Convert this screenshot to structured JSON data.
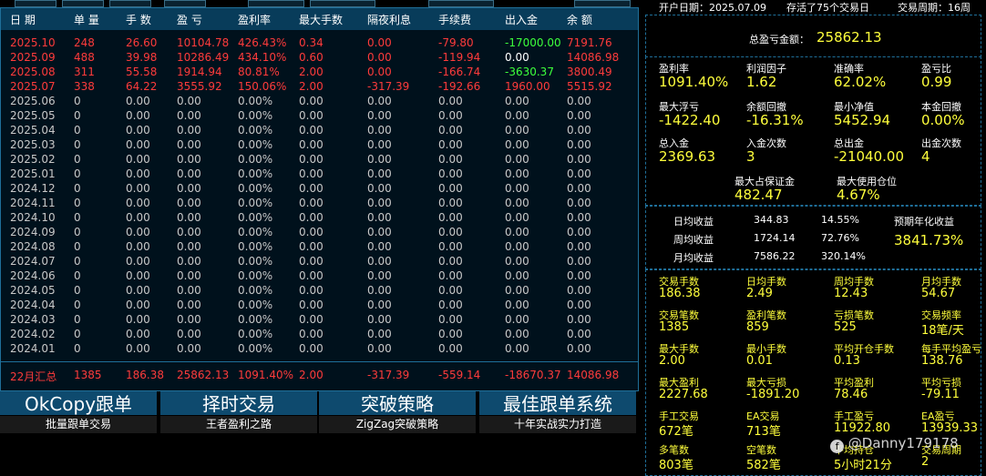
{
  "table": {
    "headers": [
      "日 期",
      "单 量",
      "手 数",
      "盈 亏",
      "盈利率",
      "最大手数",
      "隔夜利息",
      "手续费",
      "出入金",
      "余 额"
    ],
    "rows": [
      [
        "2025.10",
        "248",
        "26.60",
        "10104.78",
        "426.43%",
        "0.34",
        "0.00",
        "-79.80",
        "-17000.00",
        "7191.76"
      ],
      [
        "2025.09",
        "488",
        "39.98",
        "10286.49",
        "434.10%",
        "0.60",
        "0.00",
        "-119.94",
        "0.00",
        "14086.98"
      ],
      [
        "2025.08",
        "311",
        "55.58",
        "1914.94",
        "80.81%",
        "2.00",
        "0.00",
        "-166.74",
        "-3630.37",
        "3800.49"
      ],
      [
        "2025.07",
        "338",
        "64.22",
        "3555.92",
        "150.06%",
        "2.00",
        "-317.39",
        "-192.66",
        "1960.00",
        "5515.92"
      ],
      [
        "2025.06",
        "0",
        "0.00",
        "0.00",
        "0.00%",
        "0.00",
        "0.00",
        "0.00",
        "0.00",
        "0.00"
      ],
      [
        "2025.05",
        "0",
        "0.00",
        "0.00",
        "0.00%",
        "0.00",
        "0.00",
        "0.00",
        "0.00",
        "0.00"
      ],
      [
        "2025.04",
        "0",
        "0.00",
        "0.00",
        "0.00%",
        "0.00",
        "0.00",
        "0.00",
        "0.00",
        "0.00"
      ],
      [
        "2025.03",
        "0",
        "0.00",
        "0.00",
        "0.00%",
        "0.00",
        "0.00",
        "0.00",
        "0.00",
        "0.00"
      ],
      [
        "2025.02",
        "0",
        "0.00",
        "0.00",
        "0.00%",
        "0.00",
        "0.00",
        "0.00",
        "0.00",
        "0.00"
      ],
      [
        "2025.01",
        "0",
        "0.00",
        "0.00",
        "0.00%",
        "0.00",
        "0.00",
        "0.00",
        "0.00",
        "0.00"
      ],
      [
        "2024.12",
        "0",
        "0.00",
        "0.00",
        "0.00%",
        "0.00",
        "0.00",
        "0.00",
        "0.00",
        "0.00"
      ],
      [
        "2024.11",
        "0",
        "0.00",
        "0.00",
        "0.00%",
        "0.00",
        "0.00",
        "0.00",
        "0.00",
        "0.00"
      ],
      [
        "2024.10",
        "0",
        "0.00",
        "0.00",
        "0.00%",
        "0.00",
        "0.00",
        "0.00",
        "0.00",
        "0.00"
      ],
      [
        "2024.09",
        "0",
        "0.00",
        "0.00",
        "0.00%",
        "0.00",
        "0.00",
        "0.00",
        "0.00",
        "0.00"
      ],
      [
        "2024.08",
        "0",
        "0.00",
        "0.00",
        "0.00%",
        "0.00",
        "0.00",
        "0.00",
        "0.00",
        "0.00"
      ],
      [
        "2024.07",
        "0",
        "0.00",
        "0.00",
        "0.00%",
        "0.00",
        "0.00",
        "0.00",
        "0.00",
        "0.00"
      ],
      [
        "2024.06",
        "0",
        "0.00",
        "0.00",
        "0.00%",
        "0.00",
        "0.00",
        "0.00",
        "0.00",
        "0.00"
      ],
      [
        "2024.05",
        "0",
        "0.00",
        "0.00",
        "0.00%",
        "0.00",
        "0.00",
        "0.00",
        "0.00",
        "0.00"
      ],
      [
        "2024.04",
        "0",
        "0.00",
        "0.00",
        "0.00%",
        "0.00",
        "0.00",
        "0.00",
        "0.00",
        "0.00"
      ],
      [
        "2024.03",
        "0",
        "0.00",
        "0.00",
        "0.00%",
        "0.00",
        "0.00",
        "0.00",
        "0.00",
        "0.00"
      ],
      [
        "2024.02",
        "0",
        "0.00",
        "0.00",
        "0.00%",
        "0.00",
        "0.00",
        "0.00",
        "0.00",
        "0.00"
      ],
      [
        "2024.01",
        "0",
        "0.00",
        "0.00",
        "0.00%",
        "0.00",
        "0.00",
        "0.00",
        "0.00",
        "0.00"
      ]
    ],
    "summary": [
      "22月汇总",
      "1385",
      "186.38",
      "25862.13",
      "1091.40%",
      "2.00",
      "-317.39",
      "-559.14",
      "-18670.37",
      "14086.98"
    ],
    "colors": {
      "profit_row": "#ff3b3b",
      "zero_row": "#c8c8c8",
      "deposit": "#3cff3c",
      "header_bg": "#083c5a"
    }
  },
  "promos": [
    {
      "title": "OkCopy跟单",
      "sub": "批量跟单交易"
    },
    {
      "title": "择时交易",
      "sub": "王者盈利之路"
    },
    {
      "title": "突破策略",
      "sub": "ZigZag突破策略"
    },
    {
      "title": "最佳跟单系统",
      "sub": "十年实战实力打造"
    }
  ],
  "stats": {
    "header": {
      "open_date": "开户日期：2025.07.09",
      "days": "存活了75个交易日",
      "period": "交易周期：16周"
    },
    "total_label": "总盈亏金额：",
    "total_value": "25862.13",
    "grid1": [
      {
        "label": "盈利率",
        "value": "1091.40%"
      },
      {
        "label": "利润因子",
        "value": "1.62"
      },
      {
        "label": "准确率",
        "value": "62.02%"
      },
      {
        "label": "盈亏比",
        "value": "0.99"
      },
      {
        "label": "最大浮亏",
        "value": "-1422.40"
      },
      {
        "label": "余额回撤",
        "value": "-16.31%"
      },
      {
        "label": "最小净值",
        "value": "5452.94"
      },
      {
        "label": "本金回撤",
        "value": "0.00%"
      },
      {
        "label": "总入金",
        "value": "2369.63"
      },
      {
        "label": "入金次数",
        "value": "3"
      },
      {
        "label": "总出金",
        "value": "-21040.00"
      },
      {
        "label": "出金次数",
        "value": "4"
      }
    ],
    "margin": [
      {
        "label": "最大占保证金",
        "value": "482.47"
      },
      {
        "label": "最大使用仓位",
        "value": "4.67%"
      }
    ],
    "returns": [
      {
        "label": "日均收益",
        "amount": "344.83",
        "pct": "14.55%"
      },
      {
        "label": "周均收益",
        "amount": "1724.14",
        "pct": "72.76%"
      },
      {
        "label": "月均收益",
        "amount": "7586.22",
        "pct": "320.14%"
      }
    ],
    "annual_label": "预期年化收益",
    "annual_value": "3841.73%",
    "grid2": [
      {
        "label": "交易手数",
        "value": "186.38"
      },
      {
        "label": "日均手数",
        "value": "2.49"
      },
      {
        "label": "周均手数",
        "value": "12.43"
      },
      {
        "label": "月均手数",
        "value": "54.67"
      },
      {
        "label": "交易笔数",
        "value": "1385"
      },
      {
        "label": "盈利笔数",
        "value": "859"
      },
      {
        "label": "亏损笔数",
        "value": "525"
      },
      {
        "label": "交易频率",
        "value": "18笔/天"
      },
      {
        "label": "最大手数",
        "value": "2.00"
      },
      {
        "label": "最小手数",
        "value": "0.01"
      },
      {
        "label": "平均开仓手数",
        "value": "0.13"
      },
      {
        "label": "每手平均盈亏",
        "value": "138.76"
      },
      {
        "label": "最大盈利",
        "value": "2227.68"
      },
      {
        "label": "最大亏损",
        "value": "-1891.20"
      },
      {
        "label": "平均盈利",
        "value": "78.46"
      },
      {
        "label": "平均亏损",
        "value": "-79.11"
      },
      {
        "label": "手工交易",
        "value": "672笔"
      },
      {
        "label": "EA交易",
        "value": "713笔"
      },
      {
        "label": "手工盈亏",
        "value": "11922.80"
      },
      {
        "label": "EA盈亏",
        "value": "13939.33"
      },
      {
        "label": "多笔数",
        "value": "803笔"
      },
      {
        "label": "空笔数",
        "value": "582笔"
      },
      {
        "label": "平均持仓",
        "value": "5小时21分"
      },
      {
        "label": "交易周期",
        "value": "2"
      }
    ],
    "watermark": "@Danny179178"
  }
}
